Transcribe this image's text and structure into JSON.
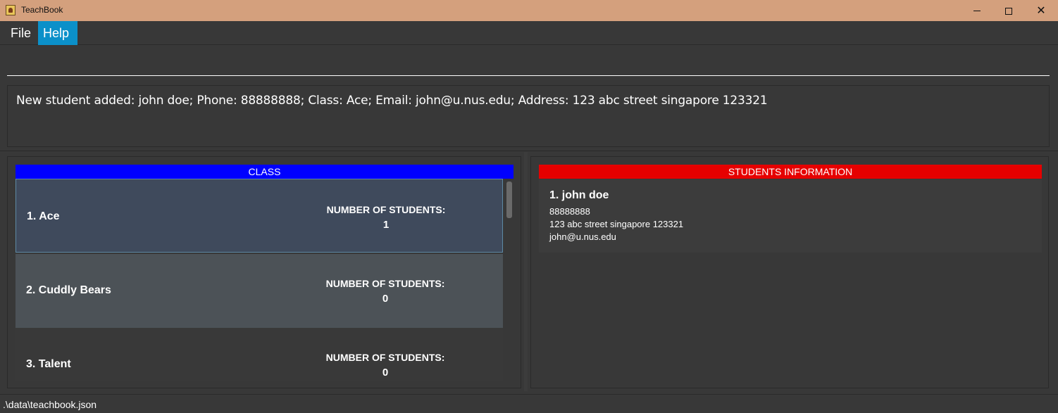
{
  "window": {
    "title": "TeachBook",
    "controls": {
      "minimize": "minimize-icon",
      "maximize": "maximize-icon",
      "close": "✕"
    }
  },
  "menu": {
    "items": [
      {
        "label": "File"
      },
      {
        "label": "Help",
        "active": true
      }
    ]
  },
  "command": {
    "value": "",
    "placeholder": ""
  },
  "result": {
    "message": "New student added: john doe; Phone: 88888888; Class: Ace; Email: john@u.nus.edu; Address: 123 abc street singapore 123321"
  },
  "class_panel": {
    "header": "CLASS",
    "header_color": "#0000ff",
    "count_label": "NUMBER OF STUDENTS:",
    "classes": [
      {
        "name": "1. Ace",
        "count": "1",
        "selected": true
      },
      {
        "name": "2. Cuddly Bears",
        "count": "0"
      },
      {
        "name": "3. Talent",
        "count": "0"
      }
    ]
  },
  "student_panel": {
    "header": "STUDENTS INFORMATION",
    "header_color": "#e60000",
    "students": [
      {
        "name": "1.  john doe",
        "phone": "88888888",
        "address": "123 abc street singapore 123321",
        "email": "john@u.nus.edu"
      }
    ]
  },
  "status": {
    "path": ".\\data\\teachbook.json"
  },
  "colors": {
    "titlebar": "#d4a07d",
    "menu_active": "#0b90c9",
    "background": "#383838"
  }
}
